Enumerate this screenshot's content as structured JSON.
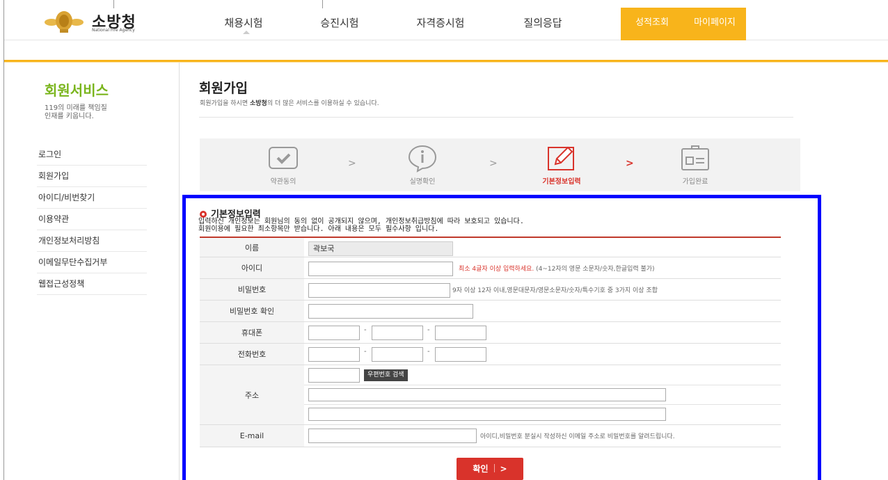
{
  "header": {
    "logo_text": "소방청",
    "logo_sub": "National Fire Agency",
    "nav": [
      {
        "label": "채용시험"
      },
      {
        "label": "승진시험"
      },
      {
        "label": "자격증시험"
      },
      {
        "label": "질의응답"
      },
      {
        "label": "성적조회"
      },
      {
        "label": "마이페이지"
      }
    ]
  },
  "sidebar": {
    "title": "회원서비스",
    "desc_line1": "119의 미래를 책임질",
    "desc_line2": "인재를 키웁니다.",
    "items": [
      {
        "label": "로그인"
      },
      {
        "label": "회원가입"
      },
      {
        "label": "아이디/비번찾기"
      },
      {
        "label": "이용약관"
      },
      {
        "label": "개인정보처리방침"
      },
      {
        "label": "이메일무단수집거부"
      },
      {
        "label": "웹접근성정책"
      }
    ]
  },
  "content": {
    "title": "회원가입",
    "desc_pre": "회원가입을 하시면 ",
    "desc_bold": "소방청",
    "desc_post": "의 더 많은 서비스를 이용하실 수 있습니다."
  },
  "steps": [
    {
      "label": "약관동의"
    },
    {
      "label": "실명확인"
    },
    {
      "label": "기본정보입력"
    },
    {
      "label": "가입완료"
    }
  ],
  "step_arrow": ">",
  "form": {
    "heading": "기본정보입력",
    "note_line1": "입력하신 개인정보는 회원님의 동의 없이 공개되지 않으며, 개인정보취급방침에 따라 보호되고 있습니다.",
    "note_line2": "회원이용에 필요한 최소항목만 받습니다. 아래 내용은 모두 필수사항 입니다.",
    "name_label": "이름",
    "name_value": "곽보국",
    "id_label": "아이디",
    "id_hint_red": "최소 4글자 이상 입력하세요.",
    "id_hint": "(4~12자의 영문 소문자/숫자,한글입력 불가)",
    "pw_label": "비밀번호",
    "pw_hint": "9자 이상 12자 이내,영문대문자/영문소문자/숫자/특수기호 중 3가지 이상 조합",
    "pw2_label": "비밀번호 확인",
    "mobile_label": "휴대폰",
    "phone_label": "전화번호",
    "dash": "-",
    "address_label": "주소",
    "zip_button": "우편번호 검색",
    "email_label": "E-mail",
    "email_hint": "아이디,비밀번호 분실시 작성하신 이메일 주소로 비밀번호를 알려드립니다.",
    "submit_label": "확인",
    "submit_arrow": ">"
  },
  "colors": {
    "accent_gold": "#f8b41b",
    "sidebar_green": "#7ab51d",
    "active_red": "#d9332b",
    "highlight_box": "#0000ff"
  }
}
